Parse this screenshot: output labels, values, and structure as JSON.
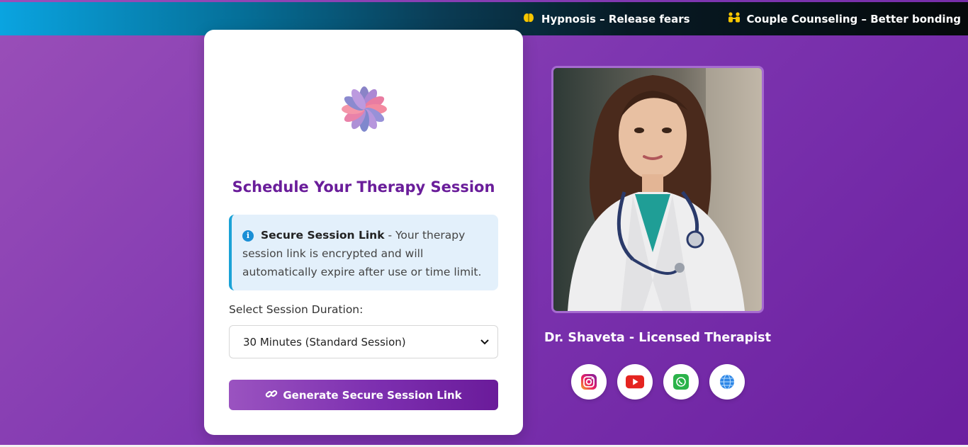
{
  "ticker": {
    "items": [
      {
        "icon": "brain-icon",
        "label": "Hypnosis – Release fears"
      },
      {
        "icon": "couple-icon",
        "label": "Couple Counseling – Better bonding"
      }
    ]
  },
  "card": {
    "title": "Schedule Your Therapy Session",
    "alert": {
      "icon": "info-icon",
      "strong": "Secure Session Link",
      "text": " - Your therapy session link is encrypted and will automatically expire after use or time limit."
    },
    "duration_label": "Select Session Duration:",
    "duration_selected": "30 Minutes (Standard Session)",
    "button_label": "Generate Secure Session Link"
  },
  "profile": {
    "name": "Dr. Shaveta - Licensed Therapist",
    "social": [
      "instagram-icon",
      "youtube-icon",
      "whatsapp-icon",
      "globe-icon"
    ]
  },
  "colors": {
    "accent": "#6a1d9a",
    "info": "#1aa2d6",
    "ticker_icon": "#f7c600"
  }
}
